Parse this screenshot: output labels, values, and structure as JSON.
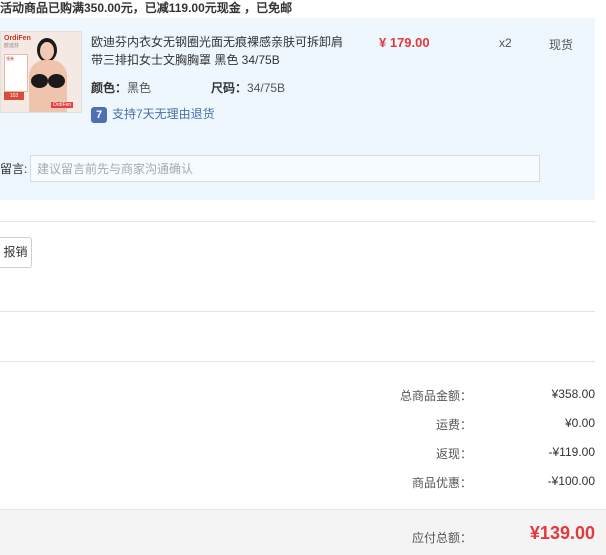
{
  "promo_text": "活动商品已购满350.00元，已减119.00元现金 ，已免邮",
  "item": {
    "title": "欧迪芬内衣女无钢圈光面无痕裸感亲肤可拆卸肩带三排扣女士文胸胸罩 黑色 34/75B",
    "price": "¥ 179.00",
    "qty": "x2",
    "stock": "现货",
    "color_label": "颜色：",
    "color_value": "黑色",
    "size_label": "尺码：",
    "size_value": "34/75B",
    "return_icon": "7",
    "return_text": "支持7天无理由退货",
    "thumb": {
      "brand": "OrdiFen",
      "brand_sub": "欧迪芬",
      "promo_line": "领券",
      "tag": "103",
      "bottom_tag": "OrdiFen"
    }
  },
  "message": {
    "label": "留言:",
    "placeholder": "建议留言前先与商家沟通确认"
  },
  "invoice_button": "报销",
  "summary": {
    "goods_total_label": "总商品金额：",
    "goods_total_value": "¥358.00",
    "shipping_label": "运费：",
    "shipping_value": "¥0.00",
    "cashback_label": "返现：",
    "cashback_value": "-¥119.00",
    "discount_label": "商品优惠：",
    "discount_value": "-¥100.00",
    "payable_label": "应付总额：",
    "payable_value": "¥139.00"
  },
  "colors": {
    "accent_red": "#e4393c",
    "order_bg": "#eef7fd",
    "link_blue": "#4a6fa5"
  }
}
